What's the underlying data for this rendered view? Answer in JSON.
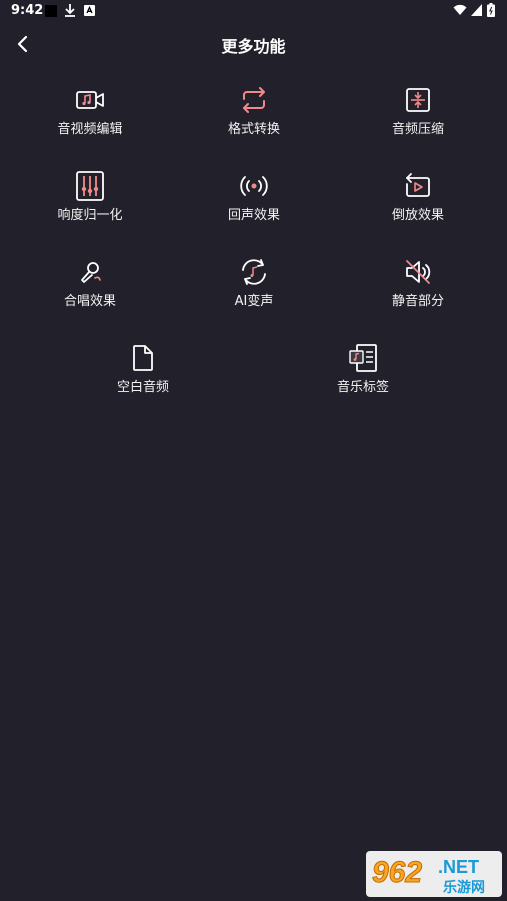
{
  "status": {
    "time": "9:42"
  },
  "header": {
    "title": "更多功能"
  },
  "features": [
    {
      "label": "音视频编辑",
      "icon": "music-video-icon"
    },
    {
      "label": "格式转换",
      "icon": "repeat-icon"
    },
    {
      "label": "音频压缩",
      "icon": "compress-icon"
    },
    {
      "label": "响度归一化",
      "icon": "equalizer-icon"
    },
    {
      "label": "回声效果",
      "icon": "broadcast-icon"
    },
    {
      "label": "倒放效果",
      "icon": "reverse-play-icon"
    },
    {
      "label": "合唱效果",
      "icon": "microphone-icon"
    },
    {
      "label": "AI变声",
      "icon": "voice-change-icon"
    },
    {
      "label": "静音部分",
      "icon": "mute-icon"
    },
    {
      "label": "空白音频",
      "icon": "blank-file-icon"
    },
    {
      "label": "音乐标签",
      "icon": "music-tag-icon"
    }
  ],
  "watermark": {
    "main": "962",
    "suffix": ".NET",
    "sub": "乐游网"
  },
  "colors": {
    "background": "#22212b",
    "accent": "#f08a8a"
  }
}
